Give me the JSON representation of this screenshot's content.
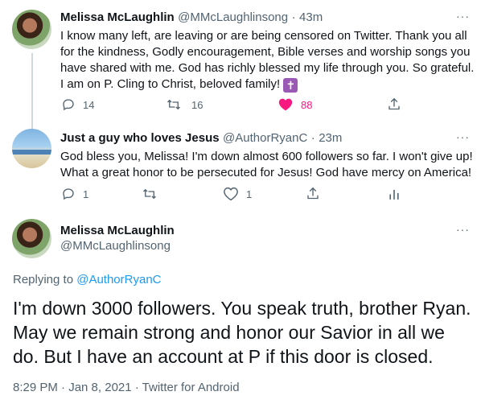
{
  "tweet1": {
    "name": "Melissa McLaughlin",
    "handle": "@MMcLaughlinsong",
    "sep": "·",
    "time": "43m",
    "more": "···",
    "line1": "I know many left, are leaving or are being censored on Twitter. Thank you all",
    "line2": "for the kindness, Godly encouragement, Bible verses and worship songs you",
    "line3": "have shared with me. God has richly blessed my life through you. So grateful.",
    "line4": "I am on P. Cling to Christ, beloved family!",
    "emoji": "✝",
    "replies": "14",
    "retweets": "16",
    "likes": "88"
  },
  "tweet2": {
    "name": "Just a guy who loves Jesus",
    "handle": "@AuthorRyanC",
    "sep": "·",
    "time": "23m",
    "more": "···",
    "line1": "God bless you, Melissa! I'm down almost 600 followers so far. I won't give up!",
    "line2": "What a great honor to be persecuted for Jesus! God have mercy on America!",
    "replies": "1",
    "retweets": "",
    "likes": "1"
  },
  "tweet3": {
    "name": "Melissa McLaughlin",
    "handle": "@MMcLaughlinsong",
    "more": "···",
    "replying_prefix": "Replying to",
    "replying_to": "@AuthorRyanC",
    "line1": "I'm down 3000 followers. You speak truth, brother Ryan.",
    "line2": "May we remain strong and honor our Savior in all we",
    "line3": "do. But I have an account at P if this door is closed.",
    "meta": "8:29 PM · Jan 8, 2021 · Twitter for Android"
  },
  "icons": {
    "reply": "reply-icon",
    "retweet": "retweet-icon",
    "like": "heart-icon",
    "share": "share-icon",
    "analytics": "analytics-icon"
  },
  "colors": {
    "like_active": "#f91880",
    "link": "#1d9bf0",
    "secondary": "#536471"
  }
}
